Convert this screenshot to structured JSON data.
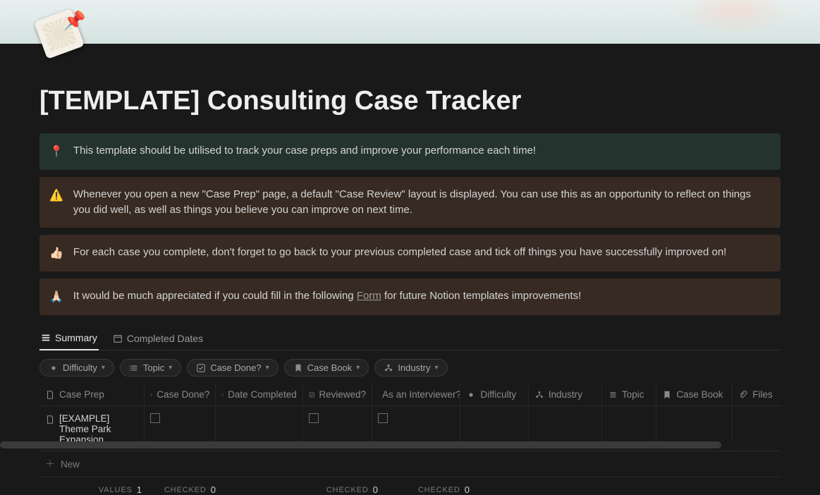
{
  "page": {
    "title": "[TEMPLATE] Consulting Case Tracker"
  },
  "callouts": [
    {
      "emoji": "📍",
      "style": "green",
      "text": "This template should be utilised to track your case preps and improve your performance each time!"
    },
    {
      "emoji": "⚠️",
      "style": "brown",
      "text": "Whenever you open a new \"Case Prep\" page, a default \"Case Review\" layout is displayed. You can use this as an opportunity to reflect on things you did well, as well as things you believe you can improve on next time."
    },
    {
      "emoji": "👍🏻",
      "style": "brown",
      "text": "For each case you complete, don't forget to go back to your previous completed case and tick off things you have successfully improved on!"
    },
    {
      "emoji": "🙏🏻",
      "style": "brown",
      "text_pre": "It would be much appreciated if you could fill in the following ",
      "link_text": "Form",
      "text_post": " for future Notion templates improvements!"
    }
  ],
  "tabs": [
    {
      "label": "Summary",
      "active": true,
      "icon": "table"
    },
    {
      "label": "Completed Dates",
      "active": false,
      "icon": "calendar"
    }
  ],
  "filters": [
    {
      "label": "Difficulty",
      "icon": "sun"
    },
    {
      "label": "Topic",
      "icon": "list"
    },
    {
      "label": "Case Done?",
      "icon": "check"
    },
    {
      "label": "Case Book",
      "icon": "bookmark"
    },
    {
      "label": "Industry",
      "icon": "tree"
    }
  ],
  "columns": {
    "case_prep": "Case Prep",
    "case_done": "Case Done?",
    "date_completed": "Date Completed",
    "reviewed": "Reviewed?",
    "as_interviewer": "As an Interviewer?",
    "difficulty": "Difficulty",
    "industry": "Industry",
    "topic": "Topic",
    "case_book": "Case Book",
    "files": "Files"
  },
  "rows": [
    {
      "case_prep": "[EXAMPLE] Theme Park Expansion",
      "case_done": false,
      "date_completed": "",
      "reviewed": false,
      "as_interviewer": false,
      "difficulty": "",
      "industry": "",
      "topic": "",
      "case_book": "",
      "files": ""
    }
  ],
  "new_row_label": "New",
  "footer": {
    "values_label": "VALUES",
    "values_count": "1",
    "checked_label": "CHECKED",
    "done_count": "0",
    "reviewed_count": "0",
    "interviewer_count": "0"
  }
}
